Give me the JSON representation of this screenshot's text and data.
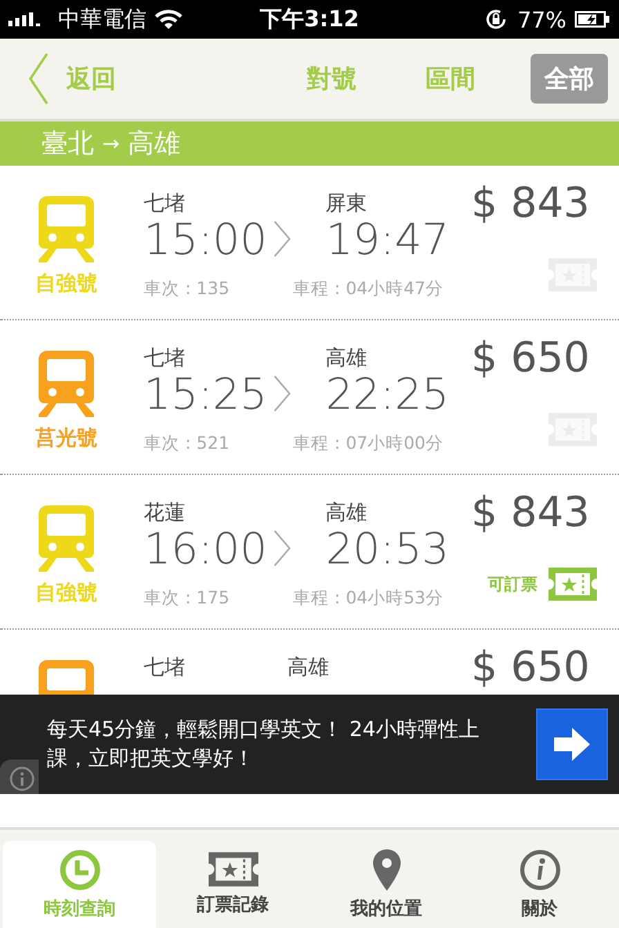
{
  "status_bar": {
    "carrier": "中華電信",
    "time": "下午3:12",
    "battery": "77%"
  },
  "nav": {
    "back": "返回",
    "filters": [
      {
        "label": "對號",
        "selected": false
      },
      {
        "label": "區間",
        "selected": false
      },
      {
        "label": "全部",
        "selected": true
      }
    ]
  },
  "route": {
    "from": "臺北",
    "arrow": "→",
    "to": "高雄"
  },
  "trains": [
    {
      "type": "自強號",
      "color": "#eed81a",
      "from": "七堵",
      "depart": "15:00",
      "to": "屏東",
      "arrive": "19:47",
      "price": "$ 843",
      "train_no": "車次 : 135",
      "duration": "車程 : 04小時47分",
      "bookable": false
    },
    {
      "type": "莒光號",
      "color": "#f7a11c",
      "from": "七堵",
      "depart": "15:25",
      "to": "高雄",
      "arrive": "22:25",
      "price": "$ 650",
      "train_no": "車次 : 521",
      "duration": "車程 : 07小時00分",
      "bookable": false
    },
    {
      "type": "自強號",
      "color": "#eed81a",
      "from": "花蓮",
      "depart": "16:00",
      "to": "高雄",
      "arrive": "20:53",
      "price": "$ 843",
      "train_no": "車次 : 175",
      "duration": "車程 : 04小時53分",
      "bookable": true,
      "book_label": "可訂票"
    },
    {
      "color": "#f7a11c",
      "from": "七堵",
      "to": "高雄",
      "price": "$ 650"
    }
  ],
  "ad": {
    "text": "每天45分鐘，輕鬆開口學英文！ 24小時彈性上課，立即把英文學好！"
  },
  "tabs": [
    {
      "label": "時刻查詢",
      "kind": "clock",
      "selected": true
    },
    {
      "label": "訂票記錄",
      "kind": "ticket",
      "selected": false
    },
    {
      "label": "我的位置",
      "kind": "pin",
      "selected": false
    },
    {
      "label": "關於",
      "kind": "info",
      "selected": false
    }
  ]
}
